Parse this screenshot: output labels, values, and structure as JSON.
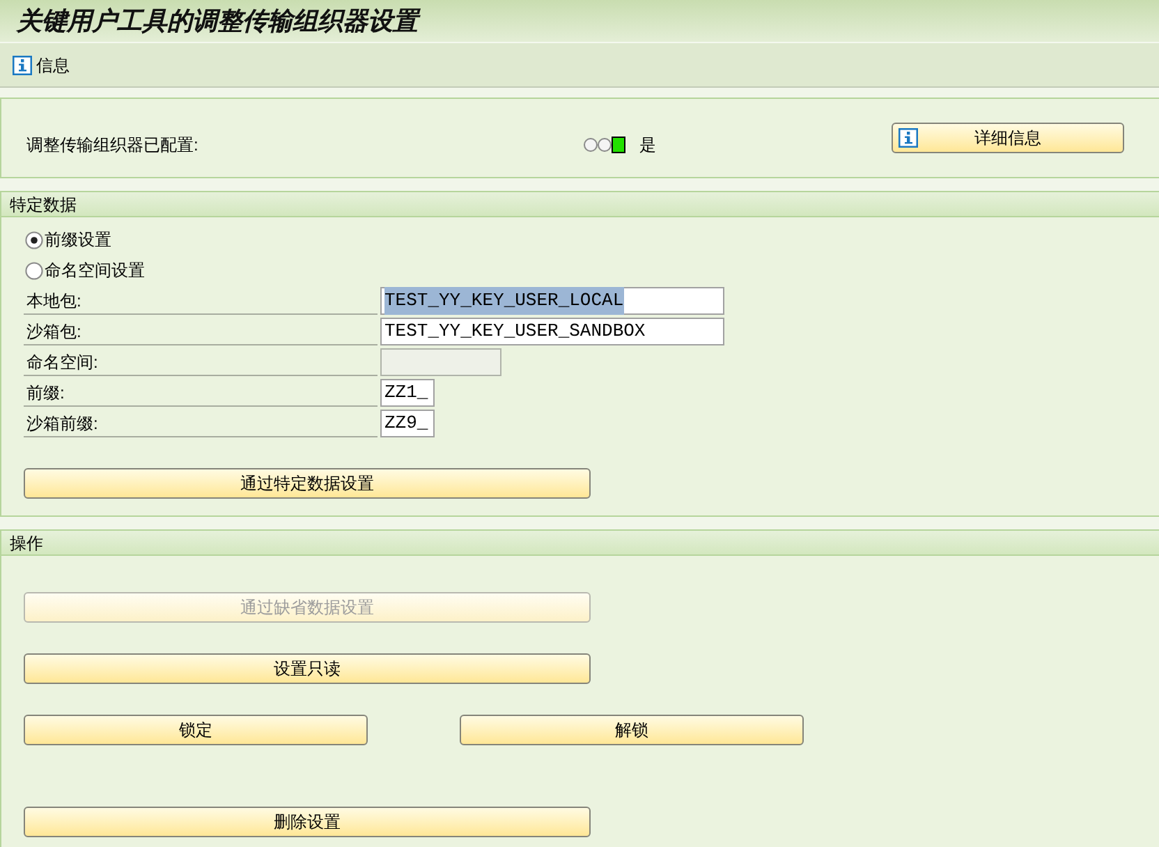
{
  "window": {
    "title": "关键用户工具的调整传输组织器设置"
  },
  "toolbar": {
    "buttons": [
      {
        "label": "信息"
      }
    ]
  },
  "status": {
    "label": "调整传输组织器已配置:",
    "lights": [
      {
        "on": false
      },
      {
        "on": false
      },
      {
        "on": true
      }
    ],
    "value": "是",
    "button": {
      "label": "详细信息",
      "disabled": false
    }
  },
  "specific_data": {
    "title": "特定数据",
    "options": [
      {
        "label": "前缀设置",
        "selected": true
      },
      {
        "label": "命名空间设置",
        "selected": false
      }
    ],
    "fields": [
      {
        "label": "本地包:",
        "value": "TEST_YY_KEY_USER_LOCAL",
        "text_selected": true,
        "disabled": false
      },
      {
        "label": "沙箱包:",
        "value": "TEST_YY_KEY_USER_SANDBOX",
        "text_selected": false,
        "disabled": false
      },
      {
        "label": "命名空间:",
        "disabled": true
      },
      {
        "label": "前缀:",
        "value": "ZZ1_",
        "text_selected": false,
        "disabled": false
      },
      {
        "label": "沙箱前缀:",
        "value": "ZZ9_",
        "text_selected": false,
        "disabled": false
      }
    ],
    "button": {
      "label": "通过特定数据设置",
      "disabled": false
    }
  },
  "actions": {
    "title": "操作",
    "rows": [
      [
        {
          "label": "通过缺省数据设置",
          "disabled": true
        }
      ],
      [
        {
          "label": "设置只读",
          "disabled": false
        }
      ],
      [
        {
          "label": "锁定",
          "disabled": false
        },
        {
          "label": "解锁",
          "disabled": false
        }
      ],
      [
        {
          "label": "删除设置",
          "disabled": false
        }
      ]
    ]
  }
}
